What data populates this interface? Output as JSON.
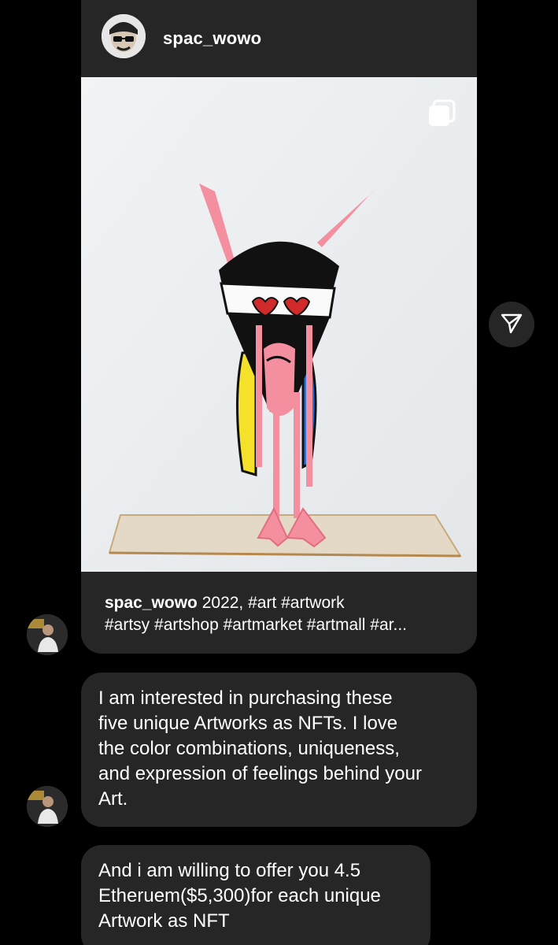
{
  "shared_post": {
    "username": "spac_wowo",
    "caption_username": "spac_wowo",
    "caption_line1": "2022, #art #artwork",
    "caption_line2": "#artsy #artshop #artmarket #artmall #ar...",
    "multi_image_icon": "carousel-icon"
  },
  "share": {
    "icon": "paper-plane-icon"
  },
  "messages": [
    {
      "lines": [
        "I am interested in purchasing these",
        "five unique Artworks as NFTs. I love",
        "the color combinations, uniqueness,",
        "and expression of feelings behind your",
        "Art."
      ]
    },
    {
      "lines": [
        "And i am willing to offer you 4.5",
        "Etheruem($5,300)for each unique",
        "Artwork as NFT"
      ]
    }
  ],
  "colors": {
    "background": "#000000",
    "bubble": "#262626",
    "text": "#ffffff"
  }
}
